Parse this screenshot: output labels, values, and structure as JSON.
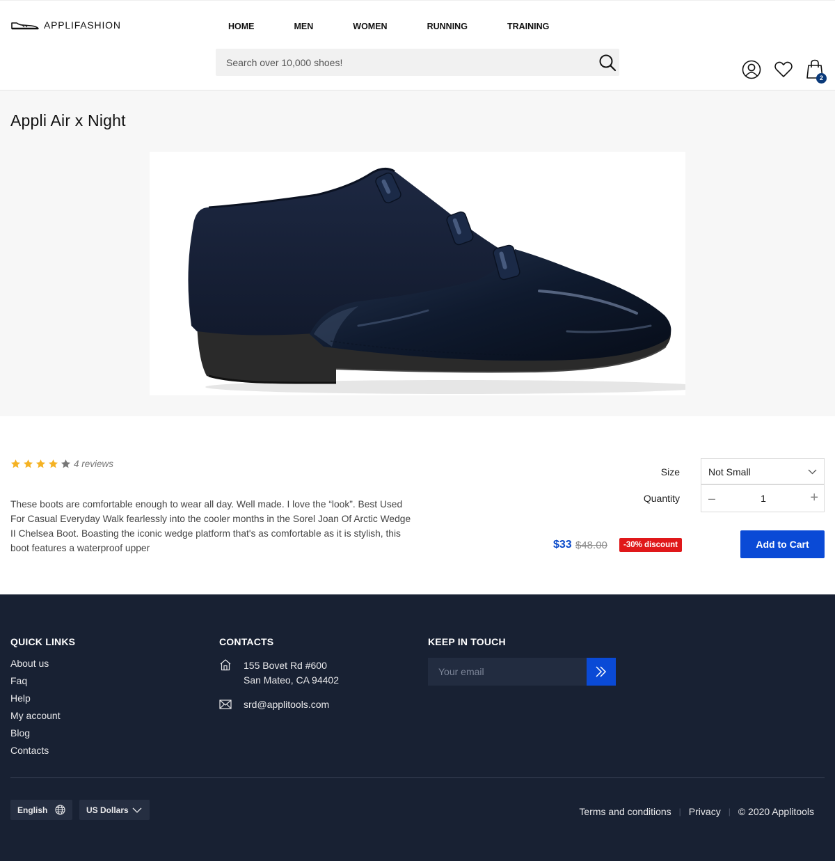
{
  "header": {
    "logo_text": "APPLIFASHION",
    "nav": [
      "HOME",
      "MEN",
      "WOMEN",
      "RUNNING",
      "TRAINING"
    ],
    "search_placeholder": "Search over 10,000 shoes!",
    "cart_count": "2"
  },
  "product": {
    "title": "Appli Air x Night",
    "rating": 4,
    "rating_max": 5,
    "reviews": "4 reviews",
    "description": "These boots are comfortable enough to wear all day. Well made. I love the “look”. Best Used For Casual Everyday Walk fearlessly into the cooler months in the Sorel Joan Of Arctic Wedge II Chelsea Boot. Boasting the iconic wedge platform that's as comfortable as it is stylish, this boot features a waterproof upper",
    "size_label": "Size",
    "size_value": "Not Small",
    "quantity_label": "Quantity",
    "quantity_value": "1",
    "quantity_minus": "–",
    "quantity_plus": "+",
    "price_new": "$33",
    "price_old": "$48.00",
    "discount": "-30% discount",
    "add_to_cart": "Add to Cart"
  },
  "footer": {
    "quick_links_title": "QUICK LINKS",
    "quick_links": [
      "About us",
      "Faq",
      "Help",
      "My account",
      "Blog",
      "Contacts"
    ],
    "contacts_title": "CONTACTS",
    "address_line1": "155 Bovet Rd #600",
    "address_line2": "San Mateo, CA 94402",
    "email": "srd@applitools.com",
    "keep_in_touch_title": "KEEP IN TOUCH",
    "email_placeholder": "Your email",
    "language": "English",
    "currency": "US Dollars",
    "terms": "Terms and conditions",
    "privacy": "Privacy",
    "copyright": "© 2020 Applitools"
  },
  "colors": {
    "accent": "#0a4ad6",
    "price": "#0a4ac9",
    "discount": "#e0181a",
    "star_filled": "#f5b223",
    "star_empty": "#777777",
    "footer_bg": "#182133",
    "hero_bg": "#f7f7f7"
  },
  "icons": [
    "shoe-logo-icon",
    "search-icon",
    "user-icon",
    "heart-icon",
    "shopping-bag-icon",
    "star-icon",
    "chevron-down-icon",
    "home-icon",
    "mail-icon",
    "double-chevron-right-icon",
    "globe-icon"
  ]
}
